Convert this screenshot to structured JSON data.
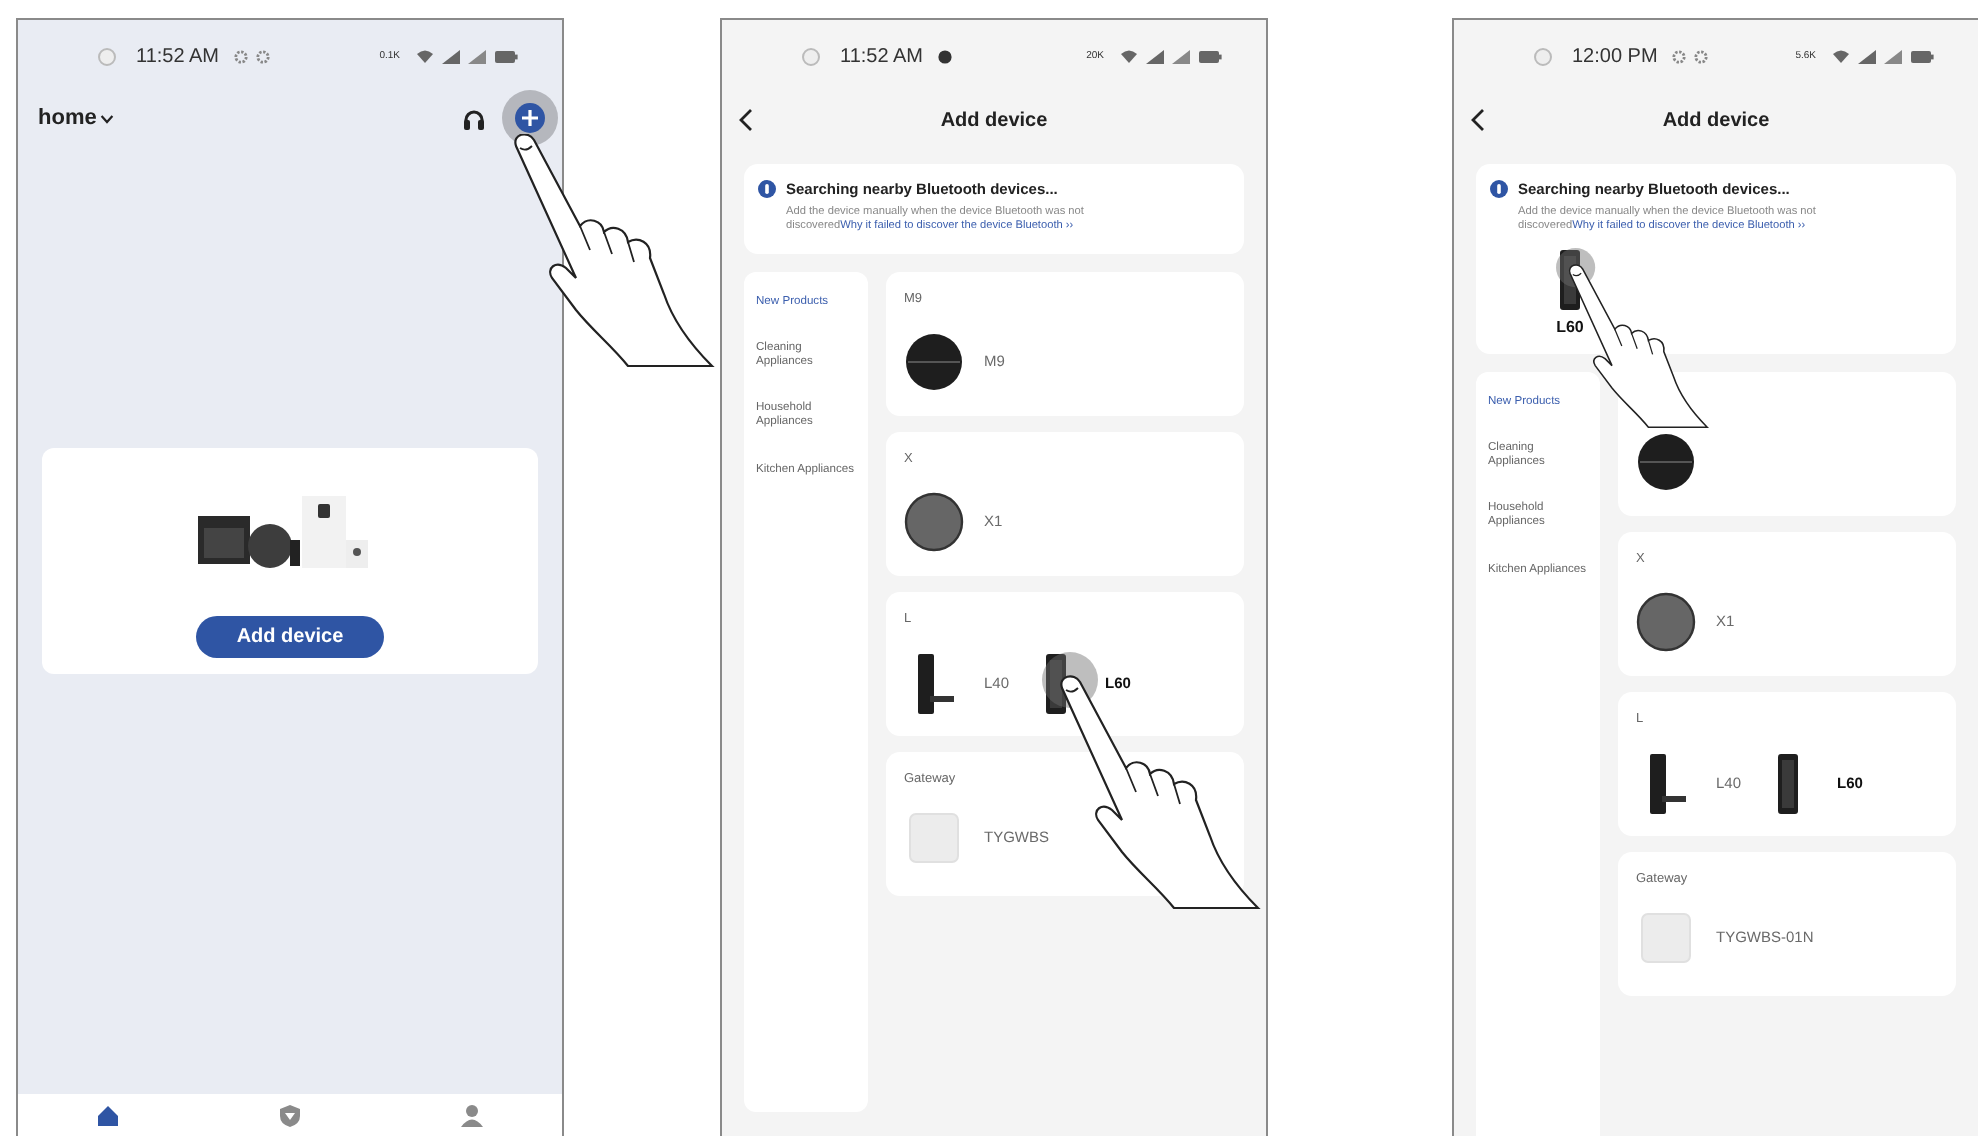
{
  "phones": [
    {
      "kind": "home",
      "status_bar": {
        "time": "11:52 AM",
        "speed": "0.1K",
        "notifications": [
          {
            "kind": "gear"
          },
          {
            "kind": "gear"
          }
        ]
      },
      "header": {
        "title": "home",
        "add_tapped": true
      },
      "empty_state": {
        "button": "Add device"
      },
      "tab_bar": [
        {
          "kind": "home",
          "selected": true
        },
        {
          "kind": "scene",
          "selected": false
        },
        {
          "kind": "profile",
          "selected": false
        }
      ]
    },
    {
      "kind": "add_device",
      "status_bar": {
        "time": "11:52 AM",
        "speed": "20K",
        "notifications": [
          {
            "kind": "alert"
          }
        ]
      },
      "title": "Add device",
      "search": {
        "title": "Searching nearby Bluetooth devices...",
        "text": "Add the device manually when the device Bluetooth was not discovered",
        "link": "Why it failed to discover the device Bluetooth ››"
      },
      "categories": [
        {
          "label": "New Products",
          "selected": true
        },
        {
          "label": "Cleaning Appliances",
          "selected": false
        },
        {
          "label": "Household Appliances",
          "selected": false
        },
        {
          "label": "Kitchen Appliances",
          "selected": false
        }
      ],
      "groups": [
        {
          "title": "M9",
          "devices": [
            {
              "name": "M9",
              "kind": "robot",
              "selected": false,
              "tapped": false
            }
          ]
        },
        {
          "title": "X",
          "devices": [
            {
              "name": "X1",
              "kind": "puck",
              "selected": false,
              "tapped": false
            }
          ]
        },
        {
          "title": "L",
          "devices": [
            {
              "name": "L40",
              "kind": "lever_lock",
              "selected": false,
              "tapped": false
            },
            {
              "name": "L60",
              "kind": "bar_lock",
              "selected": true,
              "tapped": true
            }
          ]
        },
        {
          "title": "Gateway",
          "devices": [
            {
              "name": "TYGWBS",
              "kind": "gateway",
              "selected": false,
              "tapped": false
            }
          ]
        }
      ]
    },
    {
      "kind": "add_device",
      "status_bar": {
        "time": "12:00 PM",
        "speed": "5.6K",
        "notifications": [
          {
            "kind": "gear"
          },
          {
            "kind": "gear"
          }
        ]
      },
      "title": "Add device",
      "search": {
        "title": "Searching nearby Bluetooth devices...",
        "text": "Add the device manually when the device Bluetooth was not discovered",
        "link": "Why it failed to discover the device Bluetooth ››",
        "found": [
          {
            "name": "L60",
            "kind": "bar_lock",
            "tapped": true
          }
        ]
      },
      "categories": [
        {
          "label": "New Products",
          "selected": true
        },
        {
          "label": "Cleaning Appliances",
          "selected": false
        },
        {
          "label": "Household Appliances",
          "selected": false
        },
        {
          "label": "Kitchen Appliances",
          "selected": false
        }
      ],
      "groups": [
        {
          "devices": [
            {
              "kind": "robot",
              "tapped": false
            }
          ]
        },
        {
          "title": "X",
          "devices": [
            {
              "name": "X1",
              "kind": "puck",
              "selected": false,
              "tapped": false
            }
          ]
        },
        {
          "title": "L",
          "devices": [
            {
              "name": "L40",
              "kind": "lever_lock",
              "selected": false,
              "tapped": false
            },
            {
              "name": "L60",
              "kind": "bar_lock",
              "selected": true,
              "tapped": false
            }
          ]
        },
        {
          "title": "Gateway",
          "devices": [
            {
              "name": "TYGWBS-01N",
              "kind": "gateway",
              "selected": false,
              "tapped": false
            }
          ]
        }
      ]
    }
  ]
}
